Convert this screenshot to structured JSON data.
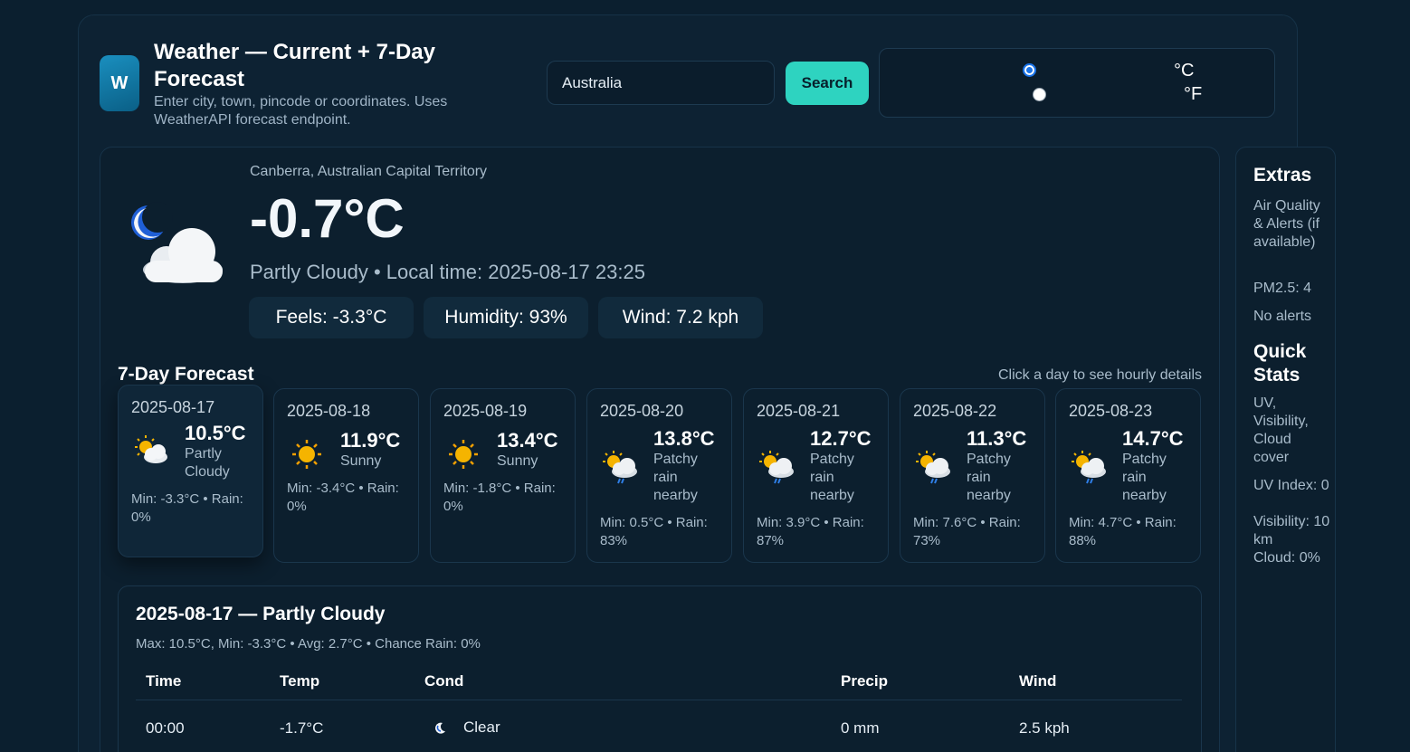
{
  "header": {
    "logo": "W",
    "title": "Weather — Current + 7-Day Forecast",
    "subtitle": "Enter city, town, pincode or coordinates. Uses WeatherAPI forecast endpoint.",
    "search_value": "Australia",
    "search_button": "Search",
    "units": [
      {
        "label": "°C",
        "checked": true
      },
      {
        "label": "°F",
        "checked": false
      }
    ]
  },
  "current": {
    "location": "Canberra, Australian Capital Territory",
    "temp": "-0.7°C",
    "condition_line": "Partly Cloudy • Local time: 2025-08-17 23:25",
    "icon": "moon-cloud-icon",
    "feels": "Feels: -3.3°C",
    "humidity": "Humidity: 93%",
    "wind": "Wind: 7.2 kph"
  },
  "forecast": {
    "title": "7-Day Forecast",
    "hint": "Click a day to see hourly details",
    "days": [
      {
        "date": "2025-08-17",
        "max": "10.5°C",
        "cond": "Partly Cloudy",
        "minrain": "Min: -3.3°C • Rain: 0%",
        "icon": "partly-cloudy-icon"
      },
      {
        "date": "2025-08-18",
        "max": "11.9°C",
        "cond": "Sunny",
        "minrain": "Min: -3.4°C • Rain: 0%",
        "icon": "sun-icon"
      },
      {
        "date": "2025-08-19",
        "max": "13.4°C",
        "cond": "Sunny",
        "minrain": "Min: -1.8°C • Rain: 0%",
        "icon": "sun-icon"
      },
      {
        "date": "2025-08-20",
        "max": "13.8°C",
        "cond": "Patchy rain nearby",
        "minrain": "Min: 0.5°C • Rain: 83%",
        "icon": "patchy-rain-icon"
      },
      {
        "date": "2025-08-21",
        "max": "12.7°C",
        "cond": "Patchy rain nearby",
        "minrain": "Min: 3.9°C • Rain: 87%",
        "icon": "patchy-rain-icon"
      },
      {
        "date": "2025-08-22",
        "max": "11.3°C",
        "cond": "Patchy rain nearby",
        "minrain": "Min: 7.6°C • Rain: 73%",
        "icon": "patchy-rain-icon"
      },
      {
        "date": "2025-08-23",
        "max": "14.7°C",
        "cond": "Patchy rain nearby",
        "minrain": "Min: 4.7°C • Rain: 88%",
        "icon": "patchy-rain-icon"
      }
    ]
  },
  "detail": {
    "title": "2025-08-17 — Partly Cloudy",
    "summary": "Max: 10.5°C, Min: -3.3°C • Avg: 2.7°C • Chance Rain: 0%",
    "headers": [
      "Time",
      "Temp",
      "Cond",
      "Precip",
      "Wind"
    ],
    "rows": [
      {
        "time": "00:00",
        "temp": "-1.7°C",
        "cond": "Clear",
        "precip": "0 mm",
        "wind": "2.5 kph",
        "icon": "moon-icon"
      }
    ]
  },
  "extras": {
    "title": "Extras",
    "aq_label": "Air Quality & Alerts (if available)",
    "pm25": "PM2.5: 4",
    "alerts": "No alerts",
    "quick_title": "Quick Stats",
    "quick_label": "UV, Visibility, Cloud cover",
    "uv": "UV Index: 0",
    "visibility": "Visibility: 10 km",
    "cloud": "Cloud: 0%"
  }
}
